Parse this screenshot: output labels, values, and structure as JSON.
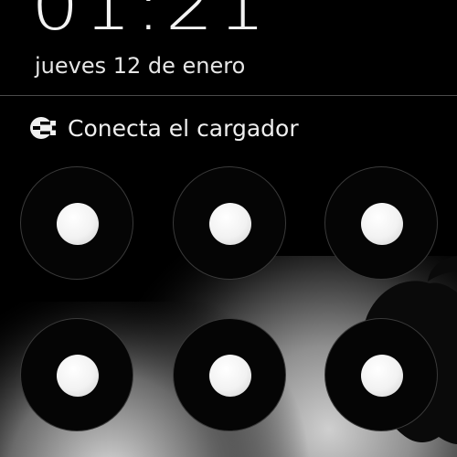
{
  "lockscreen": {
    "time": "01:21",
    "date": "jueves 12 de enero",
    "status_message": "Conecta el cargador",
    "status_icon": "charger-plug-icon"
  },
  "pattern_grid": {
    "dots": [
      {
        "id": "pattern-dot-1"
      },
      {
        "id": "pattern-dot-2"
      },
      {
        "id": "pattern-dot-3"
      },
      {
        "id": "pattern-dot-4"
      },
      {
        "id": "pattern-dot-5"
      },
      {
        "id": "pattern-dot-6"
      }
    ]
  },
  "colors": {
    "background": "#000000",
    "text": "#efefef",
    "dot": "#f2f2f2"
  }
}
